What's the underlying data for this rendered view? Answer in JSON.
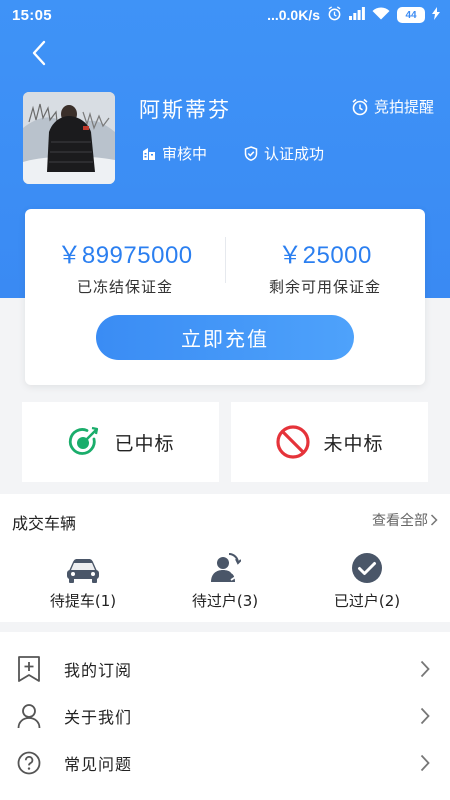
{
  "status_bar": {
    "time": "15:05",
    "network": "...0.0K/s",
    "battery": "44"
  },
  "profile": {
    "name": "阿斯蒂芬",
    "remind_label": "竞拍提醒",
    "review_status": "审核中",
    "verify_status": "认证成功"
  },
  "deposit": {
    "frozen_amount": "￥89975000",
    "frozen_label": "已冻结保证金",
    "available_amount": "￥25000",
    "available_label": "剩余可用保证金",
    "recharge_label": "立即充值"
  },
  "bids": {
    "won_label": "已中标",
    "lost_label": "未中标"
  },
  "deals": {
    "title": "成交车辆",
    "view_all": "查看全部",
    "items": [
      {
        "label": "待提车(1)",
        "icon": "car-icon"
      },
      {
        "label": "待过户(3)",
        "icon": "transfer-person-icon"
      },
      {
        "label": "已过户(2)",
        "icon": "check-circle-icon"
      }
    ]
  },
  "menu": [
    {
      "label": "我的订阅",
      "icon": "bookmark-add-icon"
    },
    {
      "label": "关于我们",
      "icon": "user-icon"
    },
    {
      "label": "常见问题",
      "icon": "question-icon"
    }
  ],
  "colors": {
    "brand_blue": "#3a8af3",
    "amount_blue": "#2b7ff0",
    "won_green": "#1aad6b",
    "lost_red": "#e5333a"
  }
}
